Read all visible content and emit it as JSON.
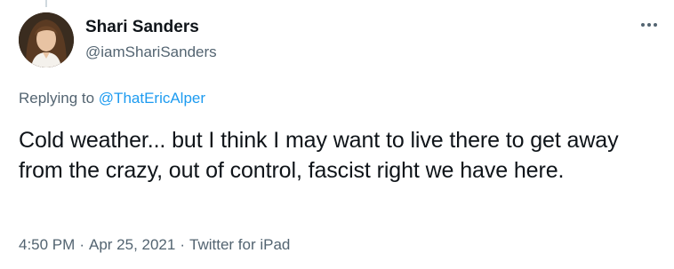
{
  "author": {
    "name": "Shari Sanders",
    "handle": "@iamShariSanders"
  },
  "more_icon": "more-horizontal-icon",
  "reply": {
    "prefix": "Replying to",
    "mention": "@ThatEricAlper"
  },
  "tweet": {
    "text": "Cold weather... but I think I may want to live there to get away from the crazy, out of control, fascist right we have here."
  },
  "meta": {
    "time": "4:50 PM",
    "separator": "·",
    "date": "Apr 25, 2021",
    "source": "Twitter for iPad"
  },
  "colors": {
    "text": "#0f1419",
    "secondary": "#536471",
    "link": "#1d9bf0"
  }
}
